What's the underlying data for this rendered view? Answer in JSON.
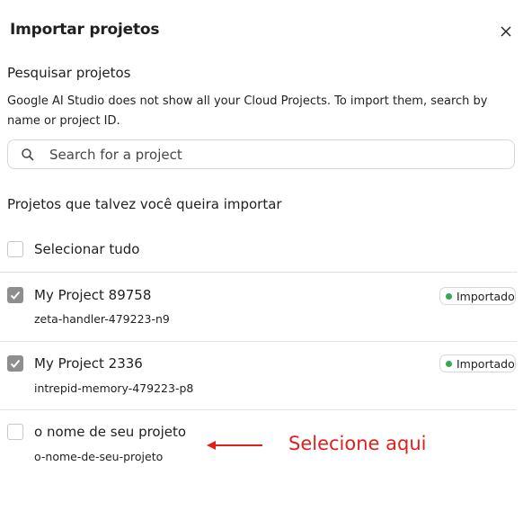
{
  "dialog": {
    "title": "Importar projetos",
    "close_icon": "close-icon"
  },
  "search_section": {
    "label": "Pesquisar projetos",
    "description": "Google AI Studio does not show all your Cloud Projects. To import them, search by name or project ID.",
    "placeholder": "Search for a project",
    "value": "",
    "icon": "search-icon"
  },
  "suggested": {
    "label": "Projetos que talvez você queira importar",
    "select_all_label": "Selecionar tudo",
    "select_all_checked": false,
    "projects": [
      {
        "name": "My Project 89758",
        "id": "zeta-handler-479223-n9",
        "checked": true,
        "badge": "Importado"
      },
      {
        "name": "My Project 2336",
        "id": "intrepid-memory-479223-p8",
        "checked": true,
        "badge": "Importado"
      },
      {
        "name": "o nome de seu projeto",
        "id": "o-nome-de-seu-projeto",
        "checked": false,
        "badge": ""
      }
    ]
  },
  "annotation": {
    "text": "Selecione aqui",
    "color": "#e0201d"
  },
  "colors": {
    "badge_dot": "#34a853",
    "checked_box": "#8e8e8e"
  }
}
